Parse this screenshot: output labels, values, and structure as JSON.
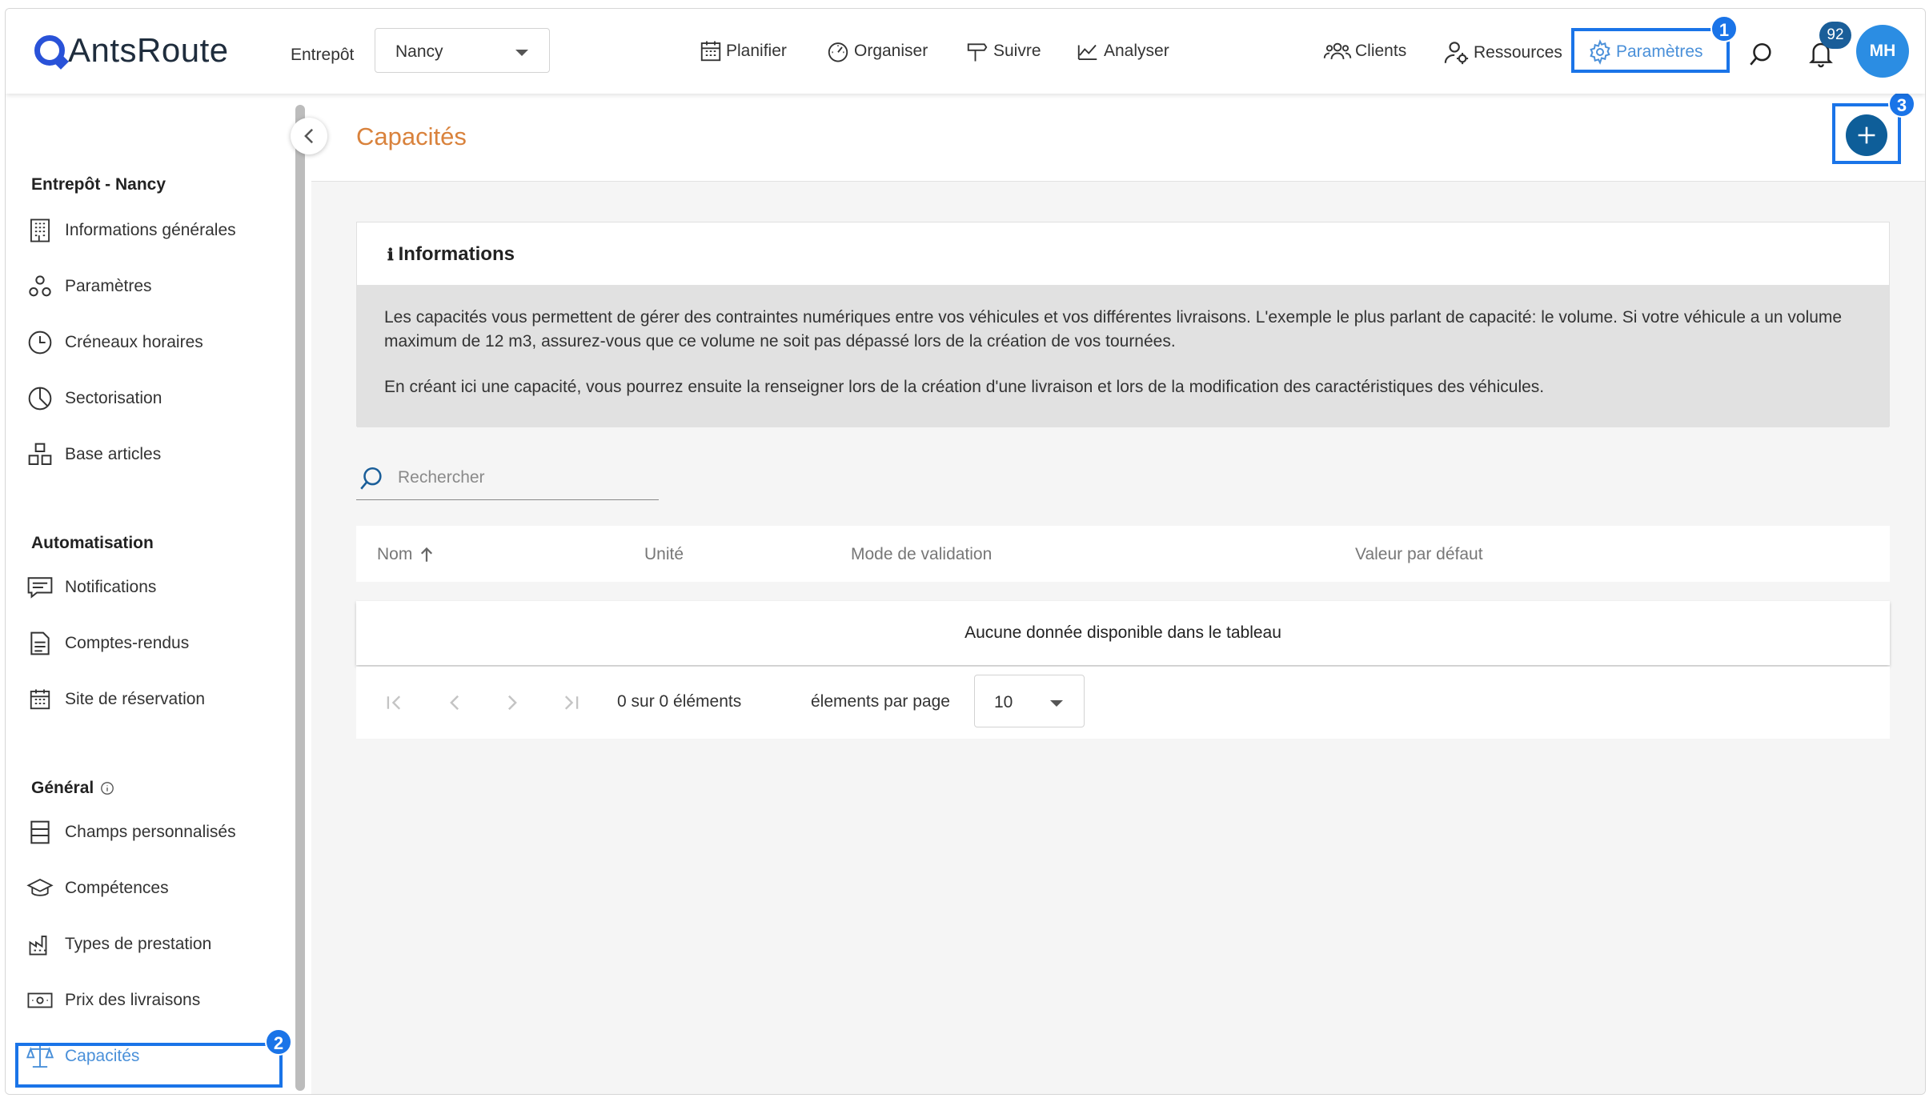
{
  "app": {
    "logo_text": "AntsRoute"
  },
  "header": {
    "warehouse_label": "Entrepôt",
    "warehouse_value": "Nancy",
    "nav": [
      "Planifier",
      "Organiser",
      "Suivre",
      "Analyser"
    ],
    "right_nav": {
      "clients": "Clients",
      "resources": "Ressources",
      "settings": "Paramètres"
    },
    "notifications_count": "92",
    "avatar_initials": "MH"
  },
  "annotations": {
    "step1": "1",
    "step2": "2",
    "step3": "3"
  },
  "sidebar": {
    "section1": "Entrepôt - Nancy",
    "section1_items": [
      "Informations générales",
      "Paramètres",
      "Créneaux horaires",
      "Sectorisation",
      "Base articles"
    ],
    "section2": "Automatisation",
    "section2_items": [
      "Notifications",
      "Comptes-rendus",
      "Site de réservation"
    ],
    "section3": "Général",
    "section3_items": [
      "Champs personnalisés",
      "Compétences",
      "Types de prestation",
      "Prix des livraisons",
      "Capacités"
    ]
  },
  "page": {
    "title": "Capacités",
    "info_title": "Informations",
    "info_p1": "Les capacités vous permettent de gérer des contraintes numériques entre vos véhicules et vos différentes livraisons. L'exemple le plus parlant de capacité: le volume. Si votre véhicule a un volume maximum de 12 m3, assurez-vous que ce volume ne soit pas dépassé lors de la création de vos tournées.",
    "info_p2": "En créant ici une capacité, vous pourrez ensuite la renseigner lors de la création d'une livraison et lors de la modification des caractéristiques des véhicules.",
    "search_placeholder": "Rechercher",
    "columns": [
      "Nom",
      "Unité",
      "Mode de validation",
      "Valeur par défaut"
    ],
    "empty_text": "Aucune donnée disponible dans le tableau",
    "pager_count": "0 sur 0 éléments",
    "per_page_label": "élements par page",
    "per_page_value": "10"
  },
  "colors": {
    "accent": "#1a74e8",
    "title_orange": "#d9823c",
    "avatar": "#2b8de3"
  }
}
